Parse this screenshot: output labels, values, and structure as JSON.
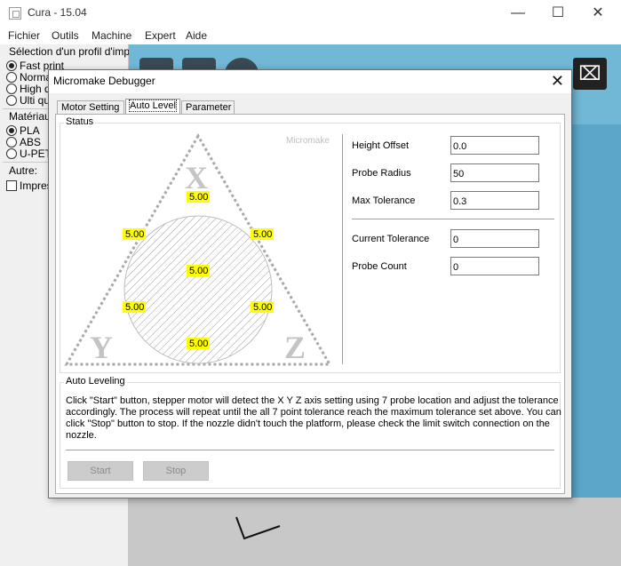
{
  "window": {
    "title": "Cura - 15.04",
    "minimize": "—",
    "maximize": "☐",
    "close": "✕"
  },
  "menu": [
    "Fichier",
    "Outils",
    "Machine",
    "Expert",
    "Aide"
  ],
  "left_panel": {
    "profile_heading": "Sélection d'un profil d'impres",
    "profiles": [
      {
        "label": "Fast print",
        "selected": true
      },
      {
        "label": "Norma",
        "selected": false
      },
      {
        "label": "High qu",
        "selected": false
      },
      {
        "label": "Ulti qu",
        "selected": false
      }
    ],
    "material_heading": "Matériau",
    "materials": [
      {
        "label": "PLA",
        "selected": true
      },
      {
        "label": "ABS",
        "selected": false
      },
      {
        "label": "U-PET",
        "selected": false
      }
    ],
    "other_heading": "Autre:",
    "other_check": "Impres"
  },
  "dialog": {
    "title": "Micromake Debugger",
    "close": "✕",
    "tabs": [
      "Motor Setting",
      "Auto Level",
      "Parameter"
    ],
    "active_tab": "Auto Level",
    "status": {
      "group_title": "Status",
      "watermark": "Micromake",
      "vertex_labels": {
        "top": "X",
        "left": "Y",
        "right": "Z"
      },
      "probe_values": [
        "5.00",
        "5.00",
        "5.00",
        "5.00",
        "5.00",
        "5.00",
        "5.00"
      ]
    },
    "fields": [
      {
        "label": "Height Offset",
        "value": "0.0"
      },
      {
        "label": "Probe Radius",
        "value": "50"
      },
      {
        "label": "Max Tolerance",
        "value": "0.3"
      },
      {
        "label": "Current Tolerance",
        "value": "0"
      },
      {
        "label": "Probe Count",
        "value": "0"
      }
    ],
    "auto_leveling": {
      "group_title": "Auto Leveling",
      "description": [
        "Click \"Start\" button, stepper motor will detect the X Y Z axis setting using 7 probe location and adjust the tolerance",
        "accordingly. The process will repeat until the all 7 point tolerance reach the maximum tolerance set above. You can",
        "click \"Stop\" button to stop. If the nozzle didn't touch the platform, please check the limit switch connection on the",
        "nozzle."
      ],
      "start_label": "Start",
      "stop_label": "Stop"
    }
  },
  "colors": {
    "viewport_blue": "#71b8d7",
    "probe_highlight": "#ffff00"
  }
}
